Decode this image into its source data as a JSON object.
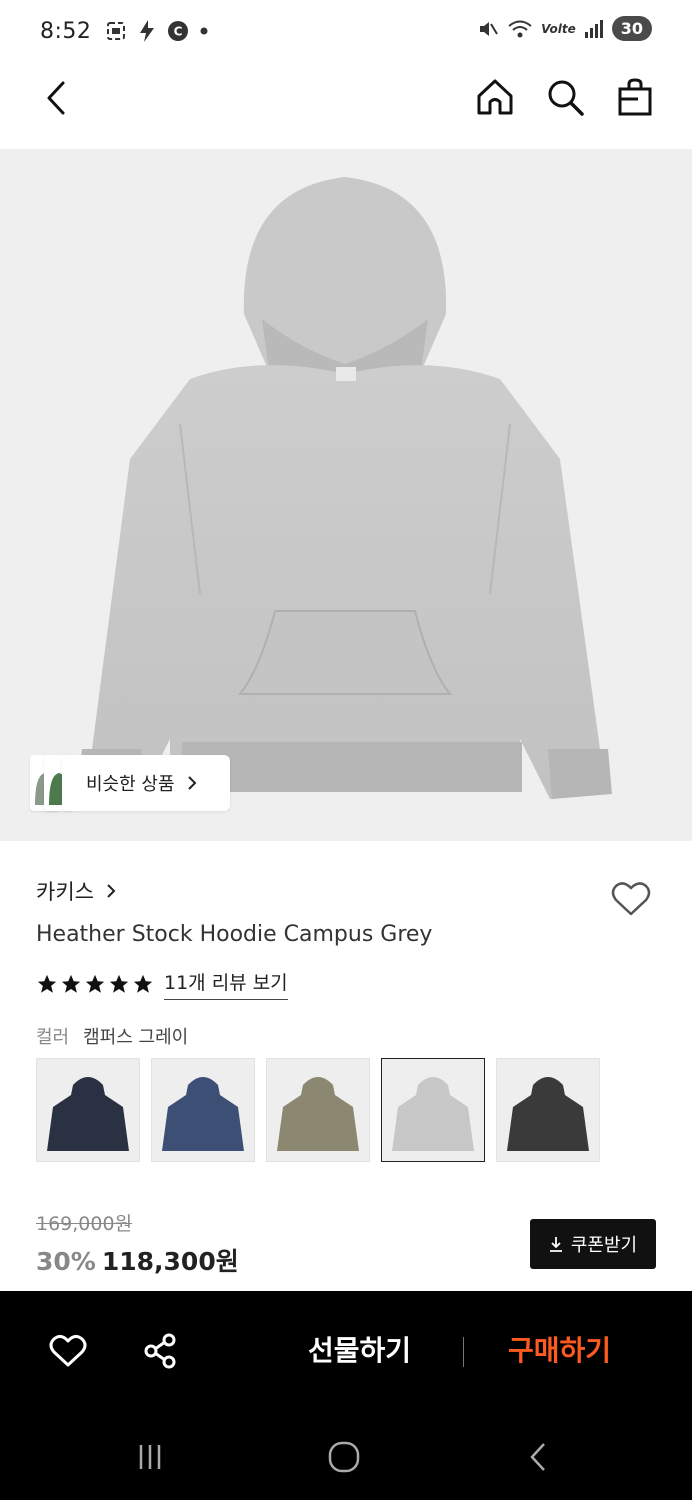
{
  "status_bar": {
    "time": "8:52",
    "battery": "30",
    "network": "Volte"
  },
  "nav": {
    "back_icon": "chevron-left-icon",
    "home_icon": "home-icon",
    "search_icon": "search-icon",
    "cart_icon": "shopping-bag-icon"
  },
  "product": {
    "similar_label": "비슷한 상품",
    "brand": "카키스",
    "title": "Heather Stock Hoodie Campus Grey",
    "rating_stars": 5,
    "review_link": "11개 리뷰 보기",
    "color_label": "컬러",
    "color_value": "캠퍼스 그레이",
    "swatches": [
      {
        "name": "navy",
        "color": "#2a3142"
      },
      {
        "name": "blue",
        "color": "#3e4f75"
      },
      {
        "name": "olive",
        "color": "#8b8770"
      },
      {
        "name": "grey",
        "color": "#c7c7c7"
      },
      {
        "name": "charcoal",
        "color": "#3a3a3a"
      }
    ],
    "selected_swatch": 3,
    "original_price": "169,000원",
    "discount": "30%",
    "sale_price": "118,300원",
    "coupon_label": "쿠폰받기"
  },
  "bottom_bar": {
    "gift_label": "선물하기",
    "buy_label": "구매하기",
    "buy_color": "#ff5a1f"
  }
}
